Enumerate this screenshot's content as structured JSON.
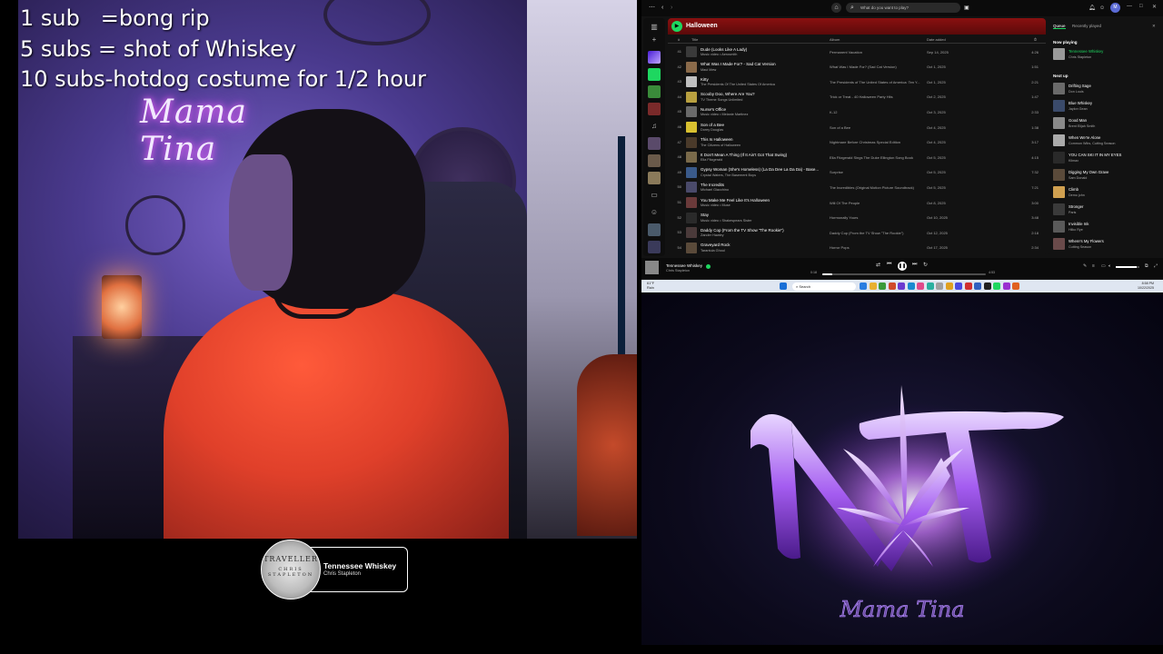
{
  "overlay": {
    "lines": [
      "1 sub   =bong rip",
      "5 subs = shot of Whiskey",
      "10 subs-hotdog costume for 1/2 hour"
    ]
  },
  "camera": {
    "neon_sign": "Mama Tina"
  },
  "now_playing_widget": {
    "title": "Tennessee Whiskey",
    "artist": "Chris Stapleton",
    "cover_text_1": "TRAVELLER",
    "cover_text_2": "CHRIS STAPLETON"
  },
  "spotify": {
    "search_placeholder": "What do you want to play?",
    "playlist_title": "Halloween",
    "columns": {
      "num": "#",
      "title": "Title",
      "album": "Album",
      "date": "Date added",
      "duration": "⏱"
    },
    "tracks": [
      {
        "num": "41",
        "title": "Dude (Looks Like A Lady)",
        "artist": "Music video • Aerosmith",
        "album": "Permanent Vacation",
        "date": "Sep 14, 2025",
        "duration": "4:26"
      },
      {
        "num": "42",
        "title": "What Was I Made For? - Sad Cat Version",
        "artist": "Maui Mew",
        "album": "What Was I Made For? (Sad Cat Version)",
        "date": "Oct 1, 2025",
        "duration": "1:51"
      },
      {
        "num": "43",
        "title": "Kitty",
        "artist": "The Presidents Of The United States Of America",
        "album": "The Presidents of The United States of America: Ten Y...",
        "date": "Oct 1, 2025",
        "duration": "2:21"
      },
      {
        "num": "44",
        "title": "Scooby Doo, Where Are You?",
        "artist": "TV Theme Songs Unlimited",
        "album": "Trick or Treat - 40 Halloween Party Hits",
        "date": "Oct 2, 2025",
        "duration": "1:47"
      },
      {
        "num": "45",
        "title": "Nurse's Office",
        "artist": "Music video • Melanie Martinez",
        "album": "K-12",
        "date": "Oct 3, 2025",
        "duration": "2:33"
      },
      {
        "num": "46",
        "title": "Son of a Bee",
        "artist": "Dorey Douglas",
        "album": "Son of a Bee",
        "date": "Oct 4, 2025",
        "duration": "1:38"
      },
      {
        "num": "47",
        "title": "This Is Halloween",
        "artist": "The Citizens of Halloween",
        "album": "Nightmare Before Christmas Special Edition",
        "date": "Oct 4, 2025",
        "duration": "3:17"
      },
      {
        "num": "48",
        "title": "It Don't Mean A Thing (If It Ain't Got That Swing)",
        "artist": "Ella Fitzgerald",
        "album": "Ella Fitzgerald Sings The Duke Ellington Song Book",
        "date": "Oct 5, 2025",
        "duration": "4:15"
      },
      {
        "num": "49",
        "title": "Gypsy Woman (She's Homeless) (La Da Dee La Da Da) - Base...",
        "artist": "Crystal Waters, The Basement Boys",
        "album": "Surprise",
        "date": "Oct 5, 2025",
        "duration": "7:32"
      },
      {
        "num": "50",
        "title": "The Incredits",
        "artist": "Michael Giacchino",
        "album": "The Incredibles (Original Motion Picture Soundtrack)",
        "date": "Oct 5, 2025",
        "duration": "7:21"
      },
      {
        "num": "51",
        "title": "You Make Me Feel Like It's Halloween",
        "artist": "Music video • Muse",
        "album": "Will Of The People",
        "date": "Oct 8, 2025",
        "duration": "3:00"
      },
      {
        "num": "52",
        "title": "Stay",
        "artist": "Music video • Shakespears Sister",
        "album": "Hormonally Yours",
        "date": "Oct 10, 2025",
        "duration": "3:48"
      },
      {
        "num": "53",
        "title": "Daddy Cop (From the TV Show \"The Rookie\")",
        "artist": "Zander Hawley",
        "album": "Daddy Cop (From the TV Show \"The Rookie\")",
        "date": "Oct 12, 2025",
        "duration": "2:18"
      },
      {
        "num": "54",
        "title": "Graveyard Rock",
        "artist": "Tarantula Ghoul",
        "album": "Horror Pops",
        "date": "Oct 17, 2025",
        "duration": "2:34"
      }
    ],
    "queue": {
      "tab_queue": "Queue",
      "tab_recent": "Recently played",
      "now_playing_label": "Now playing",
      "now_playing": {
        "title": "Tennessee Whiskey",
        "artist": "Chris Stapleton"
      },
      "next_up_label": "Next up",
      "items": [
        {
          "title": "Drifting Sage",
          "artist": "Don Louis"
        },
        {
          "title": "Blue Whiskey",
          "artist": "Jaylon Gean"
        },
        {
          "title": "Good Man",
          "artist": "Brent Elijah Smith"
        },
        {
          "title": "When We're Alone",
          "artist": "Common Wibs, Cutting Season"
        },
        {
          "title": "YOU CAN SKI IT IN MY EYES",
          "artist": "Klimax"
        },
        {
          "title": "Digging My Own Grave",
          "artist": "Sam Donald"
        },
        {
          "title": "Climb",
          "artist": "Demo john"
        },
        {
          "title": "Stronger",
          "artist": "Paris"
        },
        {
          "title": "Invisible Ink",
          "artist": "Hilko Rye"
        },
        {
          "title": "Where's My Flowers",
          "artist": "Cutting Season"
        }
      ]
    },
    "player": {
      "title": "Tennessee Whiskey",
      "artist": "Chris Stapleton",
      "elapsed": "0:18",
      "total": "4:53",
      "progress_fraction": 0.06,
      "volume_fraction": 0.9
    },
    "taskbar": {
      "weather_temp": "61°F",
      "weather_desc": "Rain",
      "search_placeholder": "Search",
      "time": "8:58 PM",
      "date": "10/22/2025"
    }
  },
  "logo": {
    "caption": "Mama Tina"
  }
}
